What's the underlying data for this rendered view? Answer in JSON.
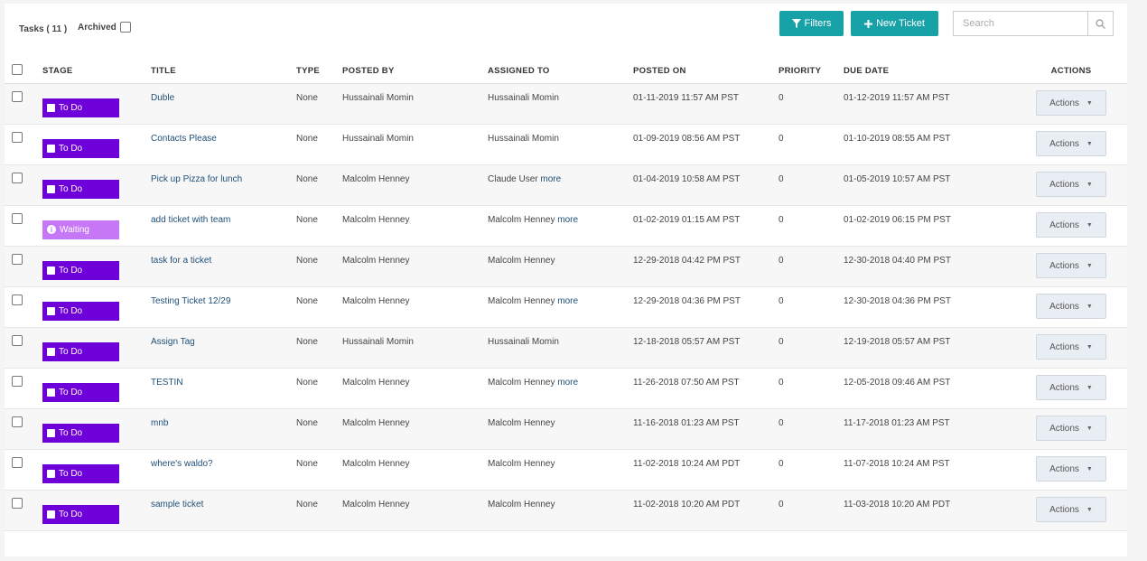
{
  "toolbar": {
    "tasks_label": "Tasks ( 11 )",
    "archived_label": "Archived",
    "filters_label": "Filters",
    "new_ticket_label": "New Ticket",
    "search_placeholder": "Search"
  },
  "columns": {
    "stage": "STAGE",
    "title": "TITLE",
    "type": "TYPE",
    "posted_by": "POSTED BY",
    "assigned_to": "ASSIGNED TO",
    "posted_on": "POSTED ON",
    "priority": "PRIORITY",
    "due_date": "DUE DATE",
    "actions": "ACTIONS"
  },
  "colors": {
    "accent": "#17a2a8",
    "stage_todo": "#6e00d9",
    "stage_waiting": "#c577f5",
    "link": "#1f4f78"
  },
  "rows": [
    {
      "stage": "To Do",
      "stage_kind": "todo",
      "title": "Duble",
      "type": "None",
      "posted_by": "Hussainali Momin",
      "assigned_to": "Hussainali Momin",
      "more": "",
      "posted_on": "01-11-2019 11:57 AM PST",
      "priority": "0",
      "due_date": "01-12-2019 11:57 AM PST",
      "action_label": "Actions"
    },
    {
      "stage": "To Do",
      "stage_kind": "todo",
      "title": "Contacts Please",
      "type": "None",
      "posted_by": "Hussainali Momin",
      "assigned_to": "Hussainali Momin",
      "more": "",
      "posted_on": "01-09-2019 08:56 AM PST",
      "priority": "0",
      "due_date": "01-10-2019 08:55 AM PST",
      "action_label": "Actions"
    },
    {
      "stage": "To Do",
      "stage_kind": "todo",
      "title": "Pick up Pizza for lunch",
      "type": "None",
      "posted_by": "Malcolm Henney",
      "assigned_to": "Claude User",
      "more": "more",
      "posted_on": "01-04-2019 10:58 AM PST",
      "priority": "0",
      "due_date": "01-05-2019 10:57 AM PST",
      "action_label": "Actions"
    },
    {
      "stage": "Waiting",
      "stage_kind": "waiting",
      "title": "add ticket with team",
      "type": "None",
      "posted_by": "Malcolm Henney",
      "assigned_to": "Malcolm Henney",
      "more": "more",
      "posted_on": "01-02-2019 01:15 AM PST",
      "priority": "0",
      "due_date": "01-02-2019 06:15 PM PST",
      "action_label": "Actions"
    },
    {
      "stage": "To Do",
      "stage_kind": "todo",
      "title": "task for a ticket",
      "type": "None",
      "posted_by": "Malcolm Henney",
      "assigned_to": "Malcolm Henney",
      "more": "",
      "posted_on": "12-29-2018 04:42 PM PST",
      "priority": "0",
      "due_date": "12-30-2018 04:40 PM PST",
      "action_label": "Actions"
    },
    {
      "stage": "To Do",
      "stage_kind": "todo",
      "title": "Testing Ticket 12/29",
      "type": "None",
      "posted_by": "Malcolm Henney",
      "assigned_to": "Malcolm Henney",
      "more": "more",
      "posted_on": "12-29-2018 04:36 PM PST",
      "priority": "0",
      "due_date": "12-30-2018 04:36 PM PST",
      "action_label": "Actions"
    },
    {
      "stage": "To Do",
      "stage_kind": "todo",
      "title": "Assign Tag",
      "type": "None",
      "posted_by": "Hussainali Momin",
      "assigned_to": "Hussainali Momin",
      "more": "",
      "posted_on": "12-18-2018 05:57 AM PST",
      "priority": "0",
      "due_date": "12-19-2018 05:57 AM PST",
      "action_label": "Actions"
    },
    {
      "stage": "To Do",
      "stage_kind": "todo",
      "title": "TESTIN",
      "type": "None",
      "posted_by": "Malcolm Henney",
      "assigned_to": "Malcolm Henney",
      "more": "more",
      "posted_on": "11-26-2018 07:50 AM PST",
      "priority": "0",
      "due_date": "12-05-2018 09:46 AM PST",
      "action_label": "Actions"
    },
    {
      "stage": "To Do",
      "stage_kind": "todo",
      "title": "mnb",
      "type": "None",
      "posted_by": "Malcolm Henney",
      "assigned_to": "Malcolm Henney",
      "more": "",
      "posted_on": "11-16-2018 01:23 AM PST",
      "priority": "0",
      "due_date": "11-17-2018 01:23 AM PST",
      "action_label": "Actions"
    },
    {
      "stage": "To Do",
      "stage_kind": "todo",
      "title": "where's waldo?",
      "type": "None",
      "posted_by": "Malcolm Henney",
      "assigned_to": "Malcolm Henney",
      "more": "",
      "posted_on": "11-02-2018 10:24 AM PDT",
      "priority": "0",
      "due_date": "11-07-2018 10:24 AM PST",
      "action_label": "Actions"
    },
    {
      "stage": "To Do",
      "stage_kind": "todo",
      "title": "sample ticket",
      "type": "None",
      "posted_by": "Malcolm Henney",
      "assigned_to": "Malcolm Henney",
      "more": "",
      "posted_on": "11-02-2018 10:20 AM PDT",
      "priority": "0",
      "due_date": "11-03-2018 10:20 AM PDT",
      "action_label": "Actions"
    }
  ]
}
